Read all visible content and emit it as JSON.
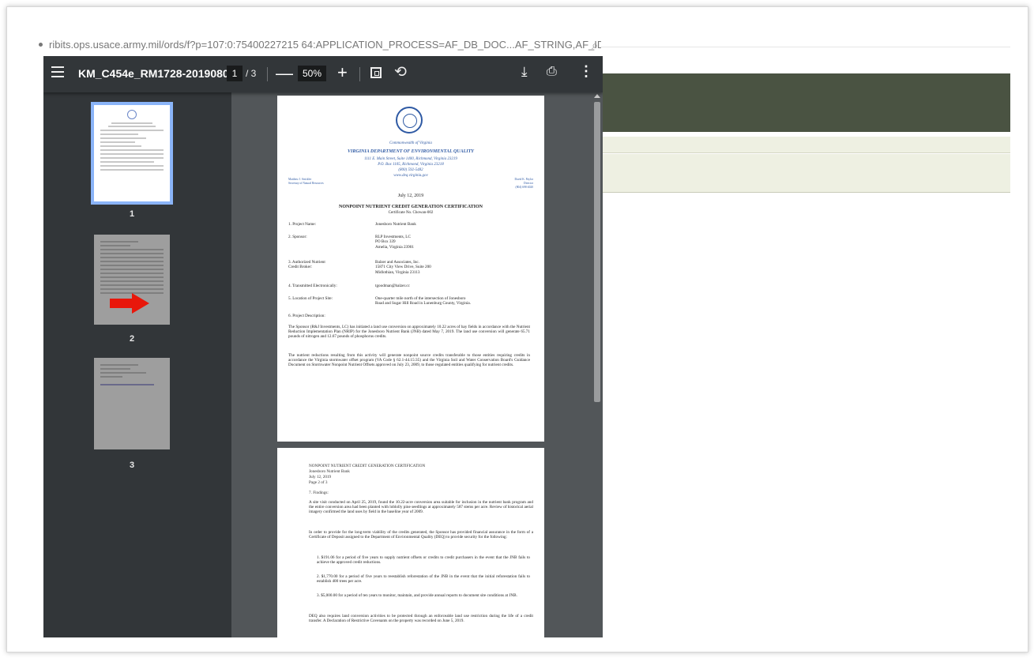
{
  "browser": {
    "url_text": "ribits.ops.usace.army.mil/ords/f?p=107:0:75400227215 64:APPLICATION_PROCESS=AF_DB_DOC...AF_STRING,AF_ID:inline:76595"
  },
  "toolbar": {
    "menu_icon": "hamburger-icon",
    "title": "KM_C454e_RM1728-2019080...",
    "page_current": "1",
    "page_total": "/ 3",
    "zoom_out": "—",
    "zoom_value": "50%",
    "zoom_in": "+",
    "fit_icon": "fit-page-icon",
    "rotate_icon": "rotate-icon",
    "download_icon": "download-icon",
    "print_icon": "print-icon",
    "more_icon": "more-vert-icon"
  },
  "thumbnails": [
    {
      "number": "1",
      "active": true
    },
    {
      "number": "2",
      "active": false,
      "annotation": "red-arrow"
    },
    {
      "number": "3",
      "active": false
    }
  ],
  "page1": {
    "commonwealth": "Commonwealth of Virginia",
    "dept": "VIRGINIA DEPARTMENT OF ENVIRONMENTAL QUALITY",
    "addr1": "1111 E. Main Street, Suite 1400, Richmond, Virginia 23219",
    "addr2": "P.O. Box 1105, Richmond, Virginia 23218",
    "phone": "(800) 592-5482",
    "web": "www.deq.virginia.gov",
    "left_name": "Matthew J. Strickler",
    "left_title": "Secretary of Natural Resources",
    "right_name": "David K. Paylor",
    "right_title": "Director",
    "right_phone": "(804) 698-4020",
    "date": "July 12, 2019",
    "heading": "NONPOINT NUTRIENT CREDIT GENERATION CERTIFICATION",
    "cert_no": "Certificate No. Chowan-002",
    "rows": [
      {
        "label": "1.  Project Name:",
        "value": "Jonesboro Nutrient Bank"
      },
      {
        "label": "2.  Sponsor:",
        "value": "RLP Investments, LC\nPO Box 339\nAmelia, Virginia 23901"
      },
      {
        "label": "3.  Authorized Nutrient\n     Credit Broker:",
        "value": "Balzer and Associates, Inc.\n15871 City View Drive, Suite 200\nMidlothian, Virginia 23113"
      },
      {
        "label": "4.  Transmitted Electronically:",
        "value": "tgoodman@balzer.cc"
      },
      {
        "label": "5.  Location of Project Site:",
        "value": "One-quarter mile north of the intersection of Jonesboro\nRoad and Sugar Hill Road in Lunenburg County, Virginia."
      },
      {
        "label": "6.  Project Description:",
        "value": ""
      }
    ],
    "para1": "The Sponsor (R&J Investments, LC) has initiated a land use conversion on approximately 10.22 acres of hay fields in accordance with the Nutrient Reduction Implementation Plan (NRIP) for the Jonesboro Nutrient Bank (JNB) dated May 7, 2019. The land use conversion will generate 65.71 pounds of nitrogen and 12.67 pounds of phosphorus credits.",
    "para2": "The nutrient reductions resulting from this activity will generate nonpoint source credits transferable to those entities requiring credits in accordance the Virginia stormwater offset program (VA Code § 62.1-44.15:35) and the Virginia Soil and Water Conservation Board's Guidance Document on Stormwater Nonpoint Nutrient Offsets approved on July 23, 2009, to those regulated entities qualifying for nutrient credits."
  },
  "page2": {
    "header1": "NONPOINT NUTRIENT CREDIT GENERATION CERTIFICATION",
    "header2": "Jonesboro Nutrient Bank",
    "header3": "July 12, 2019",
    "header4": "Page 2 of 3",
    "section": "7.  Findings:",
    "para1": "A site visit conducted on April 25, 2019, found the 10.22-acre conversion area suitable for inclusion in the nutrient bank program and the entire conversion area had been planted with loblolly pine seedlings at approximately 587 stems per acre. Review of historical aerial imagery confirmed the land uses by field in the baseline year of 2009.",
    "para2": "In order to provide for the long-term viability of the credits generated, the Sponsor has provided financial assurance in the form of a Certificate of Deposit assigned to the Department of Environmental Quality (DEQ) to provide security for the following:",
    "item1": "1.  $191.06 for a period of five years to supply nutrient offsets or credits to credit purchasers in the event that the JNB fails to achieve the approved credit reductions.",
    "item2": "2.  $1,770.00 for a period of five years to reestablish reforestation of the JNB in the event that the initial reforestation fails to establish 400 trees per acre.",
    "item3": "3.  $5,000.00 for a period of ten years to monitor, maintain, and provide annual reports to document site conditions at JNB.",
    "para3": "DEQ also requires land conversion activities to be protected through an enforceable land use restriction during the life of a credit transfer. A Declaration of Restrictive Covenants on the property was recorded on June 5, 2019."
  },
  "colors": {
    "toolbar": "#323639",
    "viewer_bg": "#525659",
    "active_thumb": "#8ab4f8",
    "arrow": "#e8170b",
    "green_band": "#4a5342",
    "tan_band": "#eef0e2",
    "dept_blue": "#2f5aa4"
  }
}
